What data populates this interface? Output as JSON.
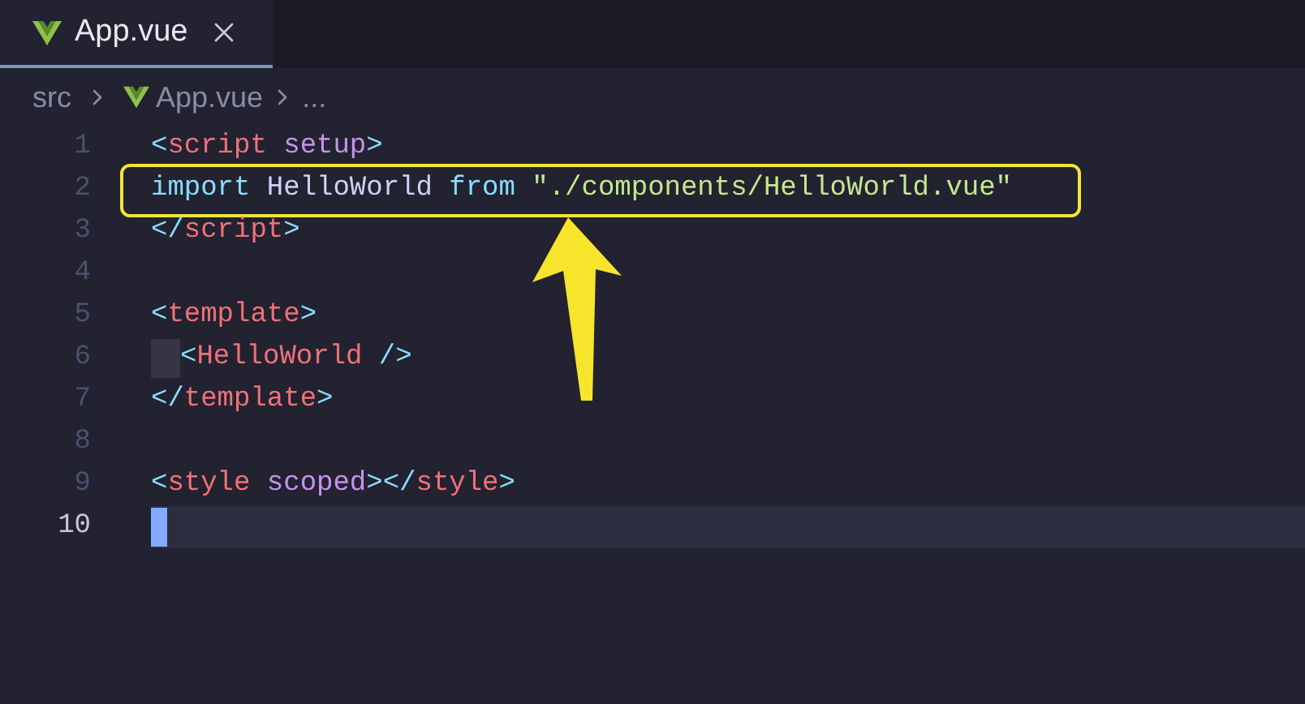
{
  "tabs": [
    {
      "label": "App.vue",
      "selected": true
    }
  ],
  "breadcrumb": {
    "folder": "src",
    "file": "App.vue",
    "more": "..."
  },
  "lines": [
    {
      "number": "1",
      "active": false,
      "indent": false,
      "highlighted": false,
      "tokens": [
        {
          "text": "<",
          "kind": "punct"
        },
        {
          "text": "script",
          "kind": "tag"
        },
        {
          "text": " setup",
          "kind": "attr"
        },
        {
          "text": ">",
          "kind": "punct"
        }
      ]
    },
    {
      "number": "2",
      "active": false,
      "indent": false,
      "highlighted": true,
      "tokens": [
        {
          "text": "import",
          "kind": "keyword"
        },
        {
          "text": " HelloWorld ",
          "kind": "text"
        },
        {
          "text": "from",
          "kind": "keyword"
        },
        {
          "text": " \"./components/HelloWorld.vue\"",
          "kind": "string"
        }
      ]
    },
    {
      "number": "3",
      "active": false,
      "indent": false,
      "highlighted": false,
      "tokens": [
        {
          "text": "</",
          "kind": "punct"
        },
        {
          "text": "script",
          "kind": "tag"
        },
        {
          "text": ">",
          "kind": "punct"
        }
      ]
    },
    {
      "number": "4",
      "active": false,
      "indent": false,
      "highlighted": false
    },
    {
      "number": "5",
      "active": false,
      "indent": false,
      "highlighted": false,
      "tokens": [
        {
          "text": "<",
          "kind": "punct"
        },
        {
          "text": "template",
          "kind": "tag"
        },
        {
          "text": ">",
          "kind": "punct"
        }
      ]
    },
    {
      "number": "6",
      "active": false,
      "indent": true,
      "highlighted": false,
      "tokens": [
        {
          "text": "<",
          "kind": "punct"
        },
        {
          "text": "HelloWorld",
          "kind": "tag"
        },
        {
          "text": " />",
          "kind": "punct"
        }
      ]
    },
    {
      "number": "7",
      "active": false,
      "indent": false,
      "highlighted": false,
      "tokens": [
        {
          "text": "</",
          "kind": "punct"
        },
        {
          "text": "template",
          "kind": "tag"
        },
        {
          "text": ">",
          "kind": "punct"
        }
      ]
    },
    {
      "number": "8",
      "active": false,
      "indent": false,
      "highlighted": false
    },
    {
      "number": "9",
      "active": false,
      "indent": false,
      "highlighted": false,
      "tokens": [
        {
          "text": "<",
          "kind": "punct"
        },
        {
          "text": "style",
          "kind": "tag"
        },
        {
          "text": " scoped",
          "kind": "attr"
        },
        {
          "text": "></",
          "kind": "punct"
        },
        {
          "text": "style",
          "kind": "tag"
        },
        {
          "text": ">",
          "kind": "punct"
        }
      ]
    },
    {
      "number": "10",
      "active": true,
      "indent": false,
      "highlighted": false
    }
  ]
}
